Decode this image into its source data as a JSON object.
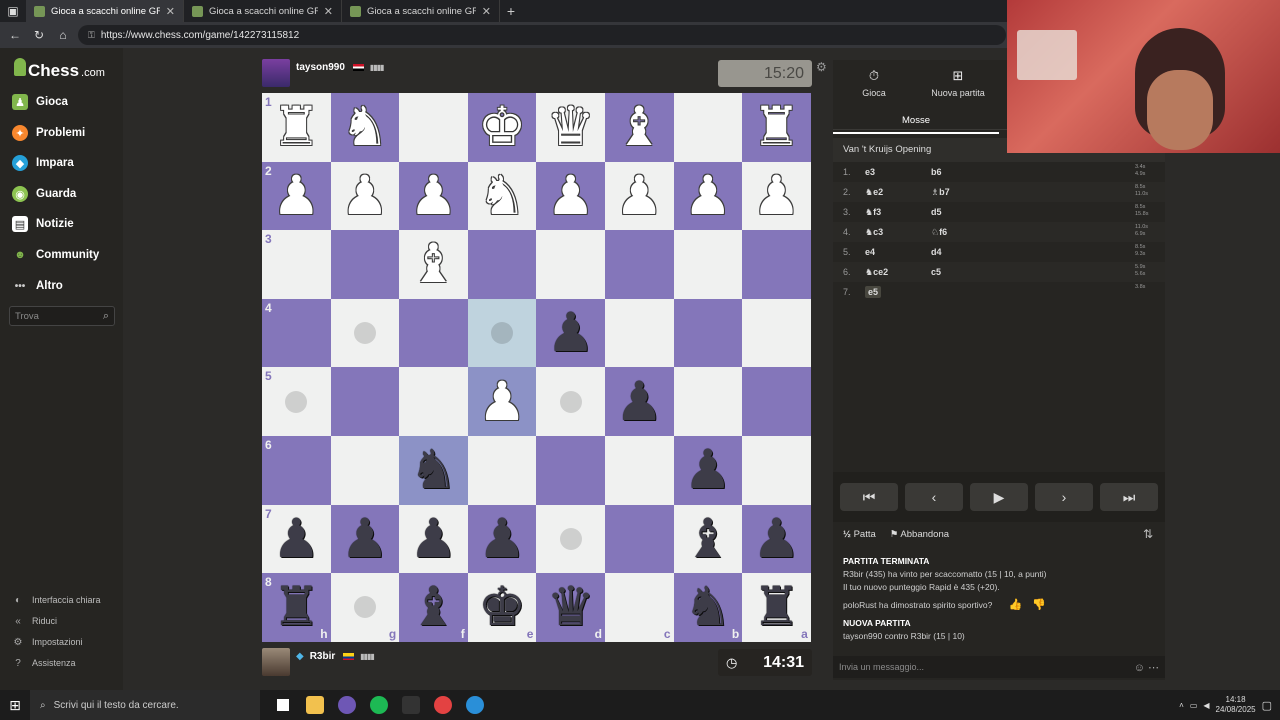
{
  "browser": {
    "tabs": [
      {
        "title": "Gioca a scacchi online GRATIS - S",
        "active": true
      },
      {
        "title": "Gioca a scacchi online GRATIS - S",
        "active": false
      },
      {
        "title": "Gioca a scacchi online GRATIS - S",
        "active": false
      }
    ],
    "url": "https://www.chess.com/game/142273115812"
  },
  "sidebar": {
    "logo_main": "Chess",
    "logo_suffix": ".com",
    "items": [
      {
        "label": "Gioca",
        "icon": "play-pawn-icon",
        "color": "#81b64c"
      },
      {
        "label": "Problemi",
        "icon": "puzzle-icon",
        "color": "#f7872e"
      },
      {
        "label": "Impara",
        "icon": "learn-icon",
        "color": "#25a0d8"
      },
      {
        "label": "Guarda",
        "icon": "watch-icon",
        "color": "#8dc451"
      },
      {
        "label": "Notizie",
        "icon": "news-icon",
        "color": "#ffffff"
      },
      {
        "label": "Community",
        "icon": "community-icon",
        "color": "#81b64c"
      },
      {
        "label": "Altro",
        "icon": "more-icon",
        "color": "#cccccc"
      }
    ],
    "search_placeholder": "Trova",
    "footer": [
      {
        "label": "Interfaccia chiara"
      },
      {
        "label": "Riduci"
      },
      {
        "label": "Impostazioni"
      },
      {
        "label": "Assistenza"
      }
    ]
  },
  "players": {
    "top": {
      "name": "tayson990",
      "clock": "15:20"
    },
    "bottom": {
      "name": "R3bir",
      "clock": "14:31"
    }
  },
  "board": {
    "ranks": [
      "1",
      "2",
      "3",
      "4",
      "5",
      "6",
      "7",
      "8"
    ],
    "files": [
      "h",
      "g",
      "f",
      "e",
      "d",
      "c",
      "b",
      "a"
    ],
    "rows": [
      [
        "wR",
        "wN",
        "",
        "wK",
        "wQ",
        "wB",
        "",
        "wR"
      ],
      [
        "wP",
        "wP",
        "wP",
        "wN",
        "wP",
        "wP",
        "wP",
        "wP"
      ],
      [
        "",
        "",
        "wB",
        "",
        "",
        "",
        "",
        ""
      ],
      [
        "",
        "dot",
        "",
        "hl-dot",
        "bP",
        "",
        "",
        ""
      ],
      [
        "dot",
        "",
        "",
        "hd-wP",
        "dot",
        "bP",
        "",
        ""
      ],
      [
        "",
        "",
        "hd-bN",
        "",
        "",
        "",
        "bP",
        ""
      ],
      [
        "bP",
        "bP",
        "bP",
        "bP",
        "dot",
        "",
        "bB",
        "bP"
      ],
      [
        "bR",
        "dot",
        "bB",
        "bK",
        "bQ",
        "",
        "bN",
        "bR"
      ]
    ]
  },
  "panel": {
    "tabs": [
      {
        "label": "Gioca",
        "icon": "timer-icon"
      },
      {
        "label": "Nuova partita",
        "icon": "plus-icon"
      }
    ],
    "subtab": "Mosse",
    "opening": "Van 't Kruijs Opening",
    "moves": [
      {
        "n": "1.",
        "white": "e3",
        "black": "b6",
        "tw": "3.4s",
        "tb": "4.9s"
      },
      {
        "n": "2.",
        "white": "♞e2",
        "black": "♗b7",
        "tw": "8.5s",
        "tb": "11.0s"
      },
      {
        "n": "3.",
        "white": "♞f3",
        "black": "d5",
        "tw": "8.5s",
        "tb": "15.8s"
      },
      {
        "n": "4.",
        "white": "♞c3",
        "black": "♘f6",
        "tw": "11.0s",
        "tb": "6.9s"
      },
      {
        "n": "5.",
        "white": "e4",
        "black": "d4",
        "tw": "8.5s",
        "tb": "9.3s"
      },
      {
        "n": "6.",
        "white": "♞ce2",
        "black": "c5",
        "tw": "5.9s",
        "tb": "5.6s"
      },
      {
        "n": "7.",
        "white": "e5",
        "black": "",
        "tw": "3.8s",
        "tb": ""
      }
    ],
    "actions": {
      "draw": "Patta",
      "resign": "Abbandona"
    },
    "chat": {
      "end_title": "PARTITA TERMINATA",
      "end_line1": "R3bir (435) ha vinto per scaccomatto (15 | 10, a punti)",
      "end_line2": "Il tuo nuovo punteggio Rapid è 435 (+20).",
      "sport_line": "poloRust ha dimostrato spirito sportivo?",
      "new_title": "NUOVA PARTITA",
      "new_line": "tayson990 contro R3bir (15 | 10)",
      "placeholder": "Invia un messaggio..."
    }
  },
  "taskbar": {
    "search": "Scrivi qui il testo da cercare.",
    "time": "14:18",
    "date": "24/08/2025"
  }
}
